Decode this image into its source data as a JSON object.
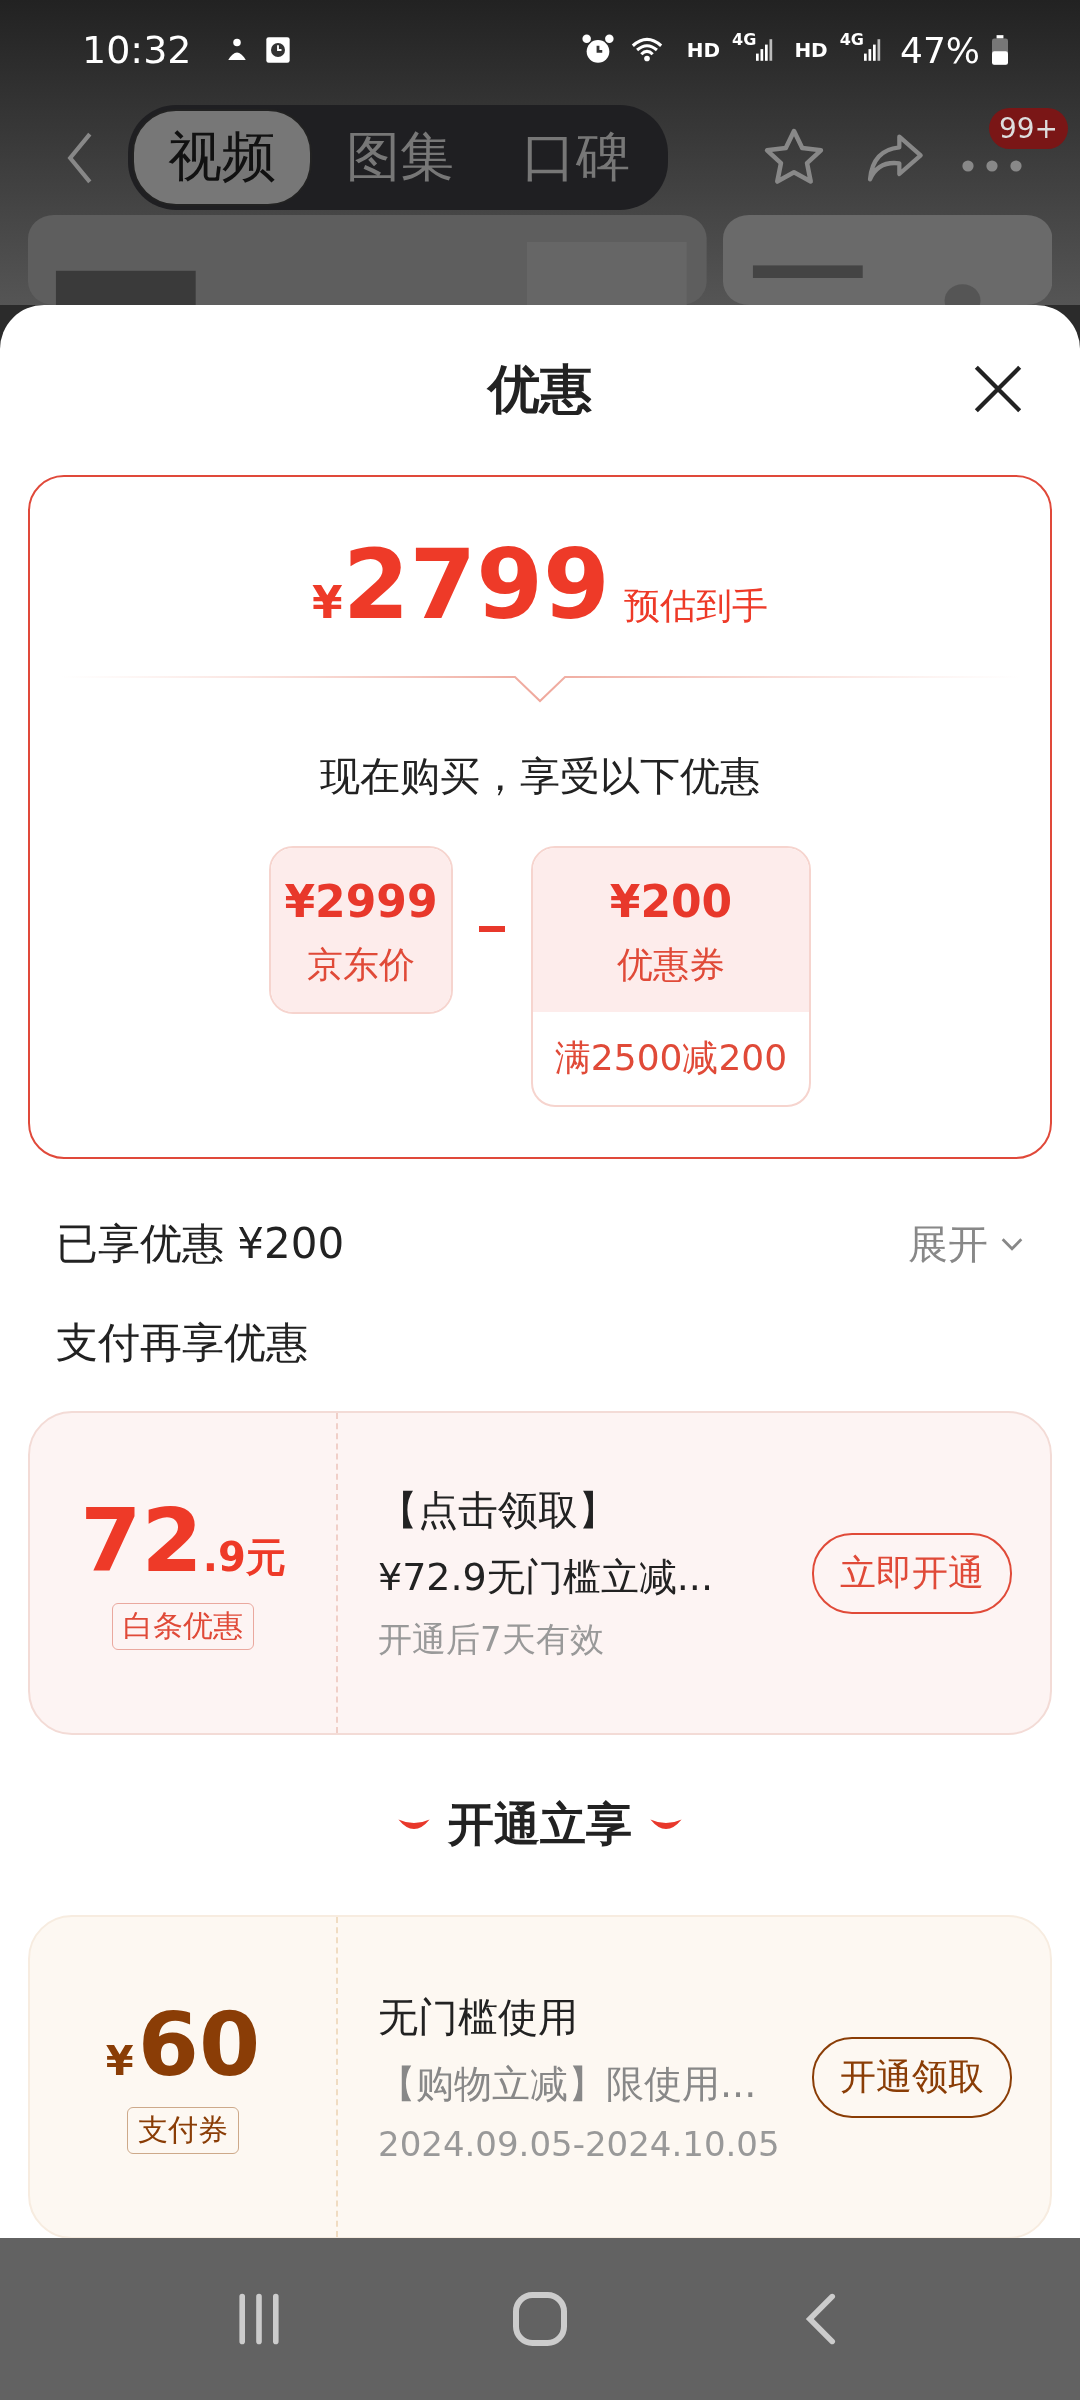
{
  "status_bar": {
    "time": "10:32",
    "signals": [
      {
        "label": "HD",
        "gen": "4G"
      },
      {
        "label": "HD",
        "gen": "4G"
      }
    ],
    "battery": "47%"
  },
  "top_nav": {
    "tabs": [
      {
        "label": "视频",
        "selected": true
      },
      {
        "label": "图集",
        "selected": false
      },
      {
        "label": "口碑",
        "selected": false
      }
    ],
    "badge": "99+"
  },
  "sheet": {
    "title": "优惠"
  },
  "price_card": {
    "symbol": "¥",
    "price": "2799",
    "price_note": "预估到手",
    "subtitle": "现在购买，享受以下优惠",
    "terms": [
      {
        "kind": "price",
        "amount": "¥2999",
        "label": "京东价"
      },
      {
        "kind": "coupon",
        "amount": "¥200",
        "label": "优惠券",
        "condition": "满2500减200"
      }
    ]
  },
  "applied": {
    "label": "已享优惠 ¥200",
    "toggle": "展开"
  },
  "section_title": "支付再享优惠",
  "offers": [
    {
      "kind": "credit",
      "amount": "72",
      "amount_small": ".9元",
      "tag": "白条优惠",
      "title": "【点击领取】",
      "desc": "¥72.9无门槛立减...",
      "note": "开通后7天有效",
      "button": "立即开通"
    }
  ],
  "divider_title": "开通立享",
  "vouchers": [
    {
      "kind": "pay",
      "symbol": "¥",
      "amount": "60",
      "tag": "支付券",
      "title": "无门槛使用",
      "desc": "【购物立减】限使用...",
      "note": "2024.09.05-2024.10.05",
      "button": "开通领取"
    }
  ]
}
